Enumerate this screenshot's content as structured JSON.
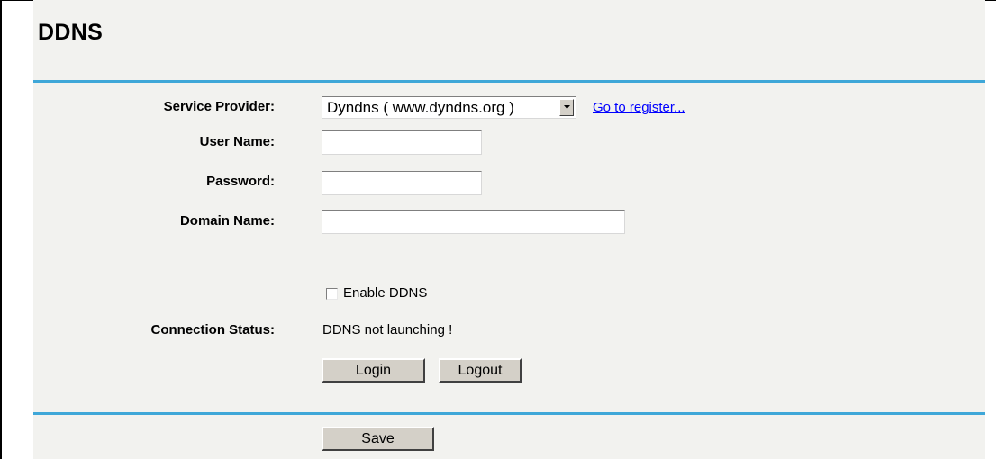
{
  "page": {
    "title": "DDNS"
  },
  "form": {
    "service_provider": {
      "label": "Service Provider:",
      "selected": "Dyndns ( www.dyndns.org )",
      "register_link": "Go to register..."
    },
    "user_name": {
      "label": "User Name:",
      "value": ""
    },
    "password": {
      "label": "Password:",
      "value": ""
    },
    "domain_name": {
      "label": "Domain Name:",
      "value": ""
    },
    "enable_ddns": {
      "label": "Enable DDNS",
      "checked": false
    },
    "connection_status": {
      "label": "Connection Status:",
      "value": "DDNS not launching !"
    }
  },
  "buttons": {
    "login": "Login",
    "logout": "Logout",
    "save": "Save"
  },
  "colors": {
    "rule": "#3fa7d8",
    "panel": "#f2f2ef",
    "link": "#0000ff",
    "button": "#d4d0c8"
  },
  "icons": {
    "select_arrow": "triangle-down-icon"
  }
}
